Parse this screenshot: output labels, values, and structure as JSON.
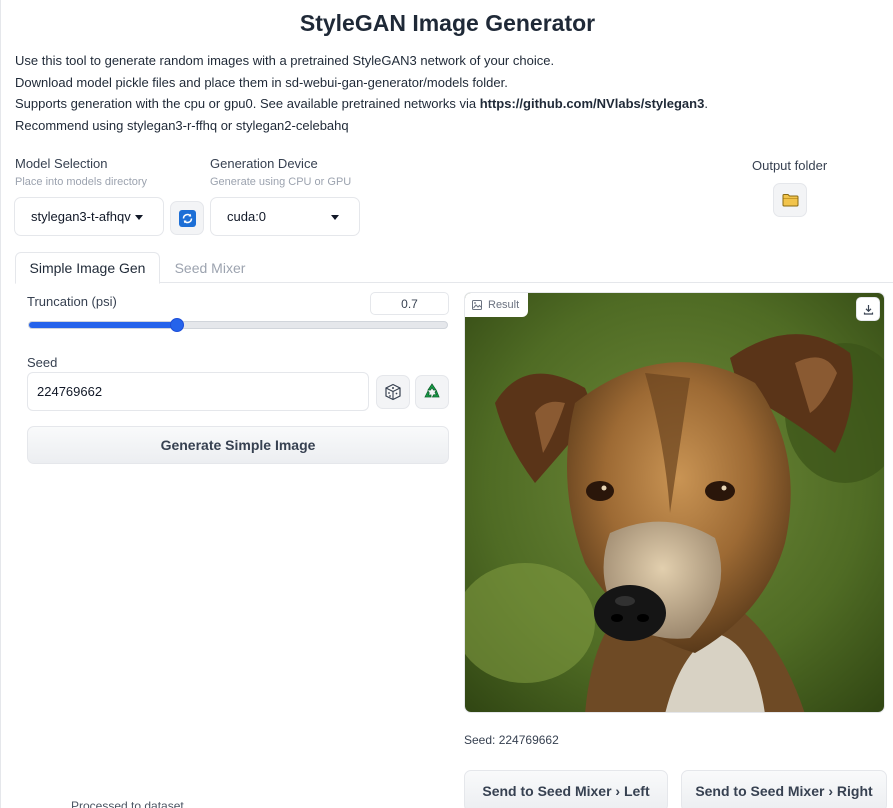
{
  "header": {
    "title": "StyleGAN Image Generator",
    "description": [
      "Use this tool to generate random images with a pretrained StyleGAN3 network of your choice.",
      "Download model pickle files and place them in sd-webui-gan-generator/models folder.",
      "Supports generation with the cpu or gpu0. See available pretrained networks via ",
      "Recommend using stylegan3-r-ffhq or stylegan2-celebahq"
    ],
    "link_text": "https://github.com/NVlabs/stylegan3",
    "link_suffix": "."
  },
  "model": {
    "label": "Model Selection",
    "sublabel": "Place into models directory",
    "value": "stylegan3-t-afhqv"
  },
  "device": {
    "label": "Generation Device",
    "sublabel": "Generate using CPU or GPU",
    "value": "cuda:0"
  },
  "output": {
    "label": "Output folder"
  },
  "tabs": [
    {
      "label": "Simple Image Gen",
      "active": true
    },
    {
      "label": "Seed Mixer",
      "active": false
    }
  ],
  "truncation": {
    "label": "Truncation (psi)",
    "value": "0.7",
    "slider_fraction": 0.355
  },
  "seed": {
    "label": "Seed",
    "value": "224769662"
  },
  "buttons": {
    "generate": "Generate Simple Image",
    "send_left": "Send to Seed Mixer › Left",
    "send_right": "Send to Seed Mixer › Right"
  },
  "result": {
    "label": "Result",
    "seed_text": "Seed: 224769662"
  },
  "footer": {
    "truncated_text": "Processed to dataset"
  },
  "colors": {
    "accent": "#2563eb",
    "refresh_icon_bg": "#1d6fd6"
  }
}
